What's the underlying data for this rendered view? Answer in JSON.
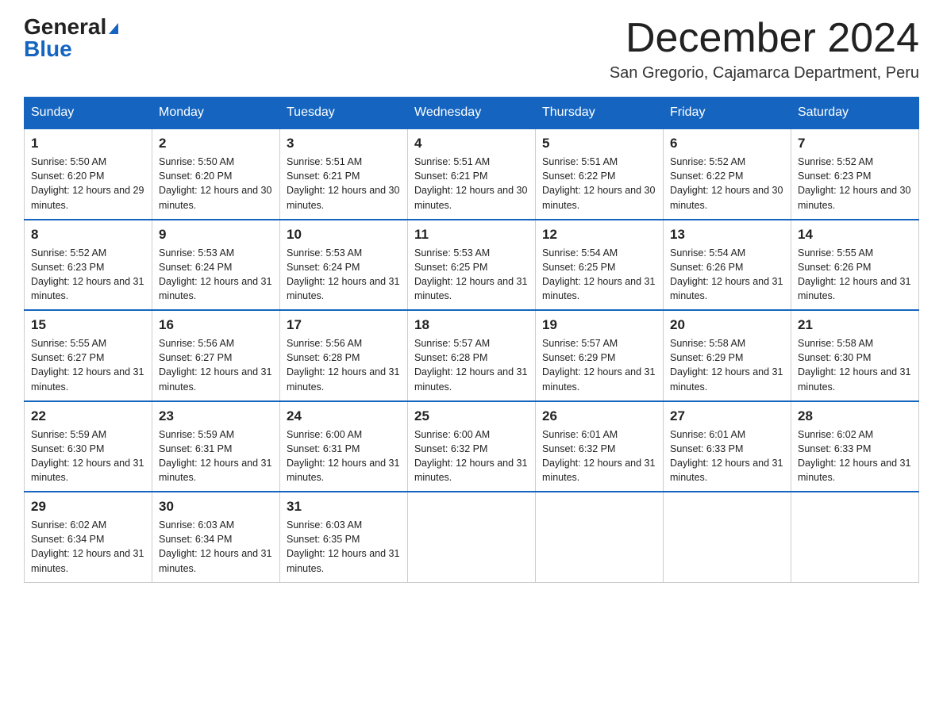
{
  "logo": {
    "general": "General",
    "triangle": "▶",
    "blue": "Blue"
  },
  "title": "December 2024",
  "subtitle": "San Gregorio, Cajamarca Department, Peru",
  "days_of_week": [
    "Sunday",
    "Monday",
    "Tuesday",
    "Wednesday",
    "Thursday",
    "Friday",
    "Saturday"
  ],
  "weeks": [
    [
      {
        "day": "1",
        "sunrise": "5:50 AM",
        "sunset": "6:20 PM",
        "daylight": "12 hours and 29 minutes."
      },
      {
        "day": "2",
        "sunrise": "5:50 AM",
        "sunset": "6:20 PM",
        "daylight": "12 hours and 30 minutes."
      },
      {
        "day": "3",
        "sunrise": "5:51 AM",
        "sunset": "6:21 PM",
        "daylight": "12 hours and 30 minutes."
      },
      {
        "day": "4",
        "sunrise": "5:51 AM",
        "sunset": "6:21 PM",
        "daylight": "12 hours and 30 minutes."
      },
      {
        "day": "5",
        "sunrise": "5:51 AM",
        "sunset": "6:22 PM",
        "daylight": "12 hours and 30 minutes."
      },
      {
        "day": "6",
        "sunrise": "5:52 AM",
        "sunset": "6:22 PM",
        "daylight": "12 hours and 30 minutes."
      },
      {
        "day": "7",
        "sunrise": "5:52 AM",
        "sunset": "6:23 PM",
        "daylight": "12 hours and 30 minutes."
      }
    ],
    [
      {
        "day": "8",
        "sunrise": "5:52 AM",
        "sunset": "6:23 PM",
        "daylight": "12 hours and 31 minutes."
      },
      {
        "day": "9",
        "sunrise": "5:53 AM",
        "sunset": "6:24 PM",
        "daylight": "12 hours and 31 minutes."
      },
      {
        "day": "10",
        "sunrise": "5:53 AM",
        "sunset": "6:24 PM",
        "daylight": "12 hours and 31 minutes."
      },
      {
        "day": "11",
        "sunrise": "5:53 AM",
        "sunset": "6:25 PM",
        "daylight": "12 hours and 31 minutes."
      },
      {
        "day": "12",
        "sunrise": "5:54 AM",
        "sunset": "6:25 PM",
        "daylight": "12 hours and 31 minutes."
      },
      {
        "day": "13",
        "sunrise": "5:54 AM",
        "sunset": "6:26 PM",
        "daylight": "12 hours and 31 minutes."
      },
      {
        "day": "14",
        "sunrise": "5:55 AM",
        "sunset": "6:26 PM",
        "daylight": "12 hours and 31 minutes."
      }
    ],
    [
      {
        "day": "15",
        "sunrise": "5:55 AM",
        "sunset": "6:27 PM",
        "daylight": "12 hours and 31 minutes."
      },
      {
        "day": "16",
        "sunrise": "5:56 AM",
        "sunset": "6:27 PM",
        "daylight": "12 hours and 31 minutes."
      },
      {
        "day": "17",
        "sunrise": "5:56 AM",
        "sunset": "6:28 PM",
        "daylight": "12 hours and 31 minutes."
      },
      {
        "day": "18",
        "sunrise": "5:57 AM",
        "sunset": "6:28 PM",
        "daylight": "12 hours and 31 minutes."
      },
      {
        "day": "19",
        "sunrise": "5:57 AM",
        "sunset": "6:29 PM",
        "daylight": "12 hours and 31 minutes."
      },
      {
        "day": "20",
        "sunrise": "5:58 AM",
        "sunset": "6:29 PM",
        "daylight": "12 hours and 31 minutes."
      },
      {
        "day": "21",
        "sunrise": "5:58 AM",
        "sunset": "6:30 PM",
        "daylight": "12 hours and 31 minutes."
      }
    ],
    [
      {
        "day": "22",
        "sunrise": "5:59 AM",
        "sunset": "6:30 PM",
        "daylight": "12 hours and 31 minutes."
      },
      {
        "day": "23",
        "sunrise": "5:59 AM",
        "sunset": "6:31 PM",
        "daylight": "12 hours and 31 minutes."
      },
      {
        "day": "24",
        "sunrise": "6:00 AM",
        "sunset": "6:31 PM",
        "daylight": "12 hours and 31 minutes."
      },
      {
        "day": "25",
        "sunrise": "6:00 AM",
        "sunset": "6:32 PM",
        "daylight": "12 hours and 31 minutes."
      },
      {
        "day": "26",
        "sunrise": "6:01 AM",
        "sunset": "6:32 PM",
        "daylight": "12 hours and 31 minutes."
      },
      {
        "day": "27",
        "sunrise": "6:01 AM",
        "sunset": "6:33 PM",
        "daylight": "12 hours and 31 minutes."
      },
      {
        "day": "28",
        "sunrise": "6:02 AM",
        "sunset": "6:33 PM",
        "daylight": "12 hours and 31 minutes."
      }
    ],
    [
      {
        "day": "29",
        "sunrise": "6:02 AM",
        "sunset": "6:34 PM",
        "daylight": "12 hours and 31 minutes."
      },
      {
        "day": "30",
        "sunrise": "6:03 AM",
        "sunset": "6:34 PM",
        "daylight": "12 hours and 31 minutes."
      },
      {
        "day": "31",
        "sunrise": "6:03 AM",
        "sunset": "6:35 PM",
        "daylight": "12 hours and 31 minutes."
      },
      null,
      null,
      null,
      null
    ]
  ],
  "colors": {
    "header_bg": "#1565c0",
    "header_text": "#ffffff",
    "border_top": "#1565c0"
  }
}
